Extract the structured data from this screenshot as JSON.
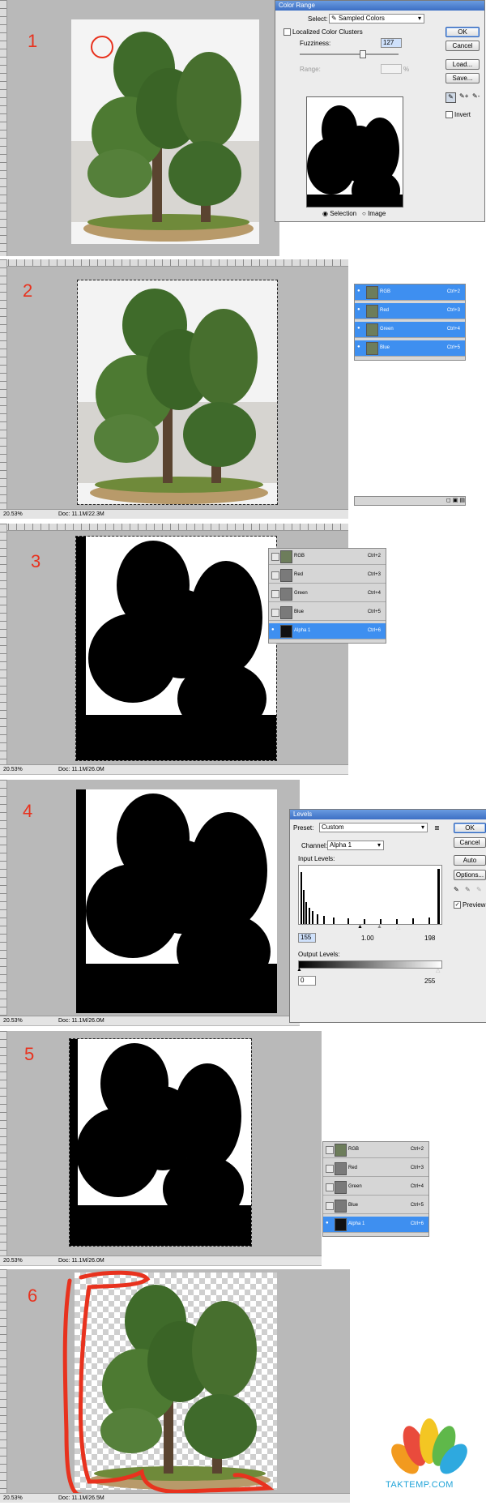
{
  "steps": [
    "1",
    "2",
    "3",
    "4",
    "5",
    "6"
  ],
  "color_range": {
    "title": "Color Range",
    "select_label": "Select:",
    "select_value": "Sampled Colors",
    "localized_label": "Localized Color Clusters",
    "fuzziness_label": "Fuzziness:",
    "fuzziness_value": "127",
    "range_label": "Range:",
    "range_unit": "%",
    "fuzziness_fraction": 0.63,
    "radio_selection": "Selection",
    "radio_image": "Image",
    "btn_ok": "OK",
    "btn_cancel": "Cancel",
    "btn_load": "Load...",
    "btn_save": "Save...",
    "invert_label": "Invert"
  },
  "status": {
    "zoom": "20.53%",
    "doc2": "Doc: 11.1M/22.3M",
    "doc3": "Doc: 11.1M/26.0M",
    "doc4": "Doc: 11.1M/26.0M",
    "doc5": "Doc: 11.1M/26.0M",
    "doc6": "Doc: 11.1M/26.5M"
  },
  "channels": [
    {
      "name": "RGB",
      "shortcut": "Ctrl+2"
    },
    {
      "name": "Red",
      "shortcut": "Ctrl+3"
    },
    {
      "name": "Green",
      "shortcut": "Ctrl+4"
    },
    {
      "name": "Blue",
      "shortcut": "Ctrl+5"
    },
    {
      "name": "Alpha 1",
      "shortcut": "Ctrl+6"
    }
  ],
  "levels": {
    "title": "Levels",
    "preset_label": "Preset:",
    "preset_value": "Custom",
    "channel_label": "Channel:",
    "channel_value": "Alpha 1",
    "input_label": "Input Levels:",
    "input_black": "155",
    "input_gamma": "1.00",
    "input_white": "198",
    "output_label": "Output Levels:",
    "output_black": "0",
    "output_white": "255",
    "btn_ok": "OK",
    "btn_cancel": "Cancel",
    "btn_auto": "Auto",
    "btn_options": "Options...",
    "preview_label": "Preview"
  },
  "brand": {
    "name": "TAKTEMP.COM"
  },
  "colors": {
    "step_red": "#e8321e",
    "selection_blue": "#3e8ff0",
    "outline_red": "#e8321e",
    "brand_blue": "#1fa3d8"
  }
}
